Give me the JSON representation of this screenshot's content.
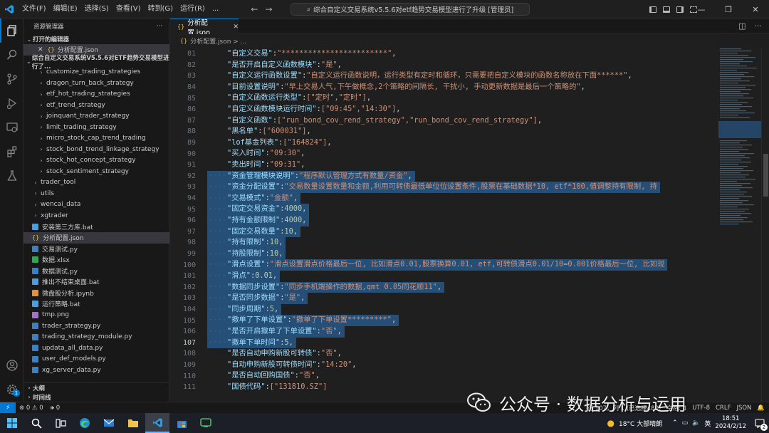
{
  "titlebar": {
    "menu": [
      "文件(F)",
      "编辑(E)",
      "选择(S)",
      "查看(V)",
      "转到(G)",
      "运行(R)",
      "..."
    ],
    "search_text": "综合自定义交易系统v5.5.6对etf趋势交易模型进行了升级 [管理员]"
  },
  "sidebar": {
    "title": "资源管理器",
    "open_editors_label": "打开的编辑器",
    "open_editor_item": "分析配置.json",
    "project_label": "综合自定义交易系统V5.5.6对ETF趋势交易模型进行了...",
    "items": [
      {
        "label": "customize_trading_strategies",
        "kind": "folder",
        "indent": 2
      },
      {
        "label": "dragon_turn_back_strategy",
        "kind": "folder",
        "indent": 2
      },
      {
        "label": "etf_hot_trading_strategies",
        "kind": "folder",
        "indent": 2
      },
      {
        "label": "etf_trend_strategy",
        "kind": "folder",
        "indent": 2
      },
      {
        "label": "joinquant_trader_strategy",
        "kind": "folder",
        "indent": 2
      },
      {
        "label": "limit_trading_strategy",
        "kind": "folder",
        "indent": 2
      },
      {
        "label": "micro_stock_cap_trend_trading",
        "kind": "folder",
        "indent": 2
      },
      {
        "label": "stock_bond_trend_linkage_strategy",
        "kind": "folder",
        "indent": 2
      },
      {
        "label": "stock_hot_concept_strategy",
        "kind": "folder",
        "indent": 2
      },
      {
        "label": "stock_sentiment_strategy",
        "kind": "folder",
        "indent": 2
      },
      {
        "label": "trader_tool",
        "kind": "folder",
        "indent": 1
      },
      {
        "label": "utils",
        "kind": "folder",
        "indent": 1
      },
      {
        "label": "wencai_data",
        "kind": "folder",
        "indent": 1
      },
      {
        "label": "xgtrader",
        "kind": "folder",
        "indent": 1
      },
      {
        "label": "安装第三方库.bat",
        "kind": "bat",
        "indent": 1
      },
      {
        "label": "分析配置.json",
        "kind": "json",
        "indent": 1,
        "active": true
      },
      {
        "label": "交易测试.py",
        "kind": "py",
        "indent": 1
      },
      {
        "label": "数据.xlsx",
        "kind": "xlsx",
        "indent": 1
      },
      {
        "label": "数据测试.py",
        "kind": "py",
        "indent": 1
      },
      {
        "label": "推出不结束桌面.bat",
        "kind": "bat",
        "indent": 1
      },
      {
        "label": "微盘股分析.ipynb",
        "kind": "ipynb",
        "indent": 1
      },
      {
        "label": "运行策略.bat",
        "kind": "bat",
        "indent": 1
      },
      {
        "label": "tmp.png",
        "kind": "png",
        "indent": 1
      },
      {
        "label": "trader_strategy.py",
        "kind": "py",
        "indent": 1
      },
      {
        "label": "trading_strategy_module.py",
        "kind": "py",
        "indent": 1
      },
      {
        "label": "updata_all_data.py",
        "kind": "py",
        "indent": 1
      },
      {
        "label": "user_def_models.py",
        "kind": "py",
        "indent": 1
      },
      {
        "label": "xg_server_data.py",
        "kind": "py",
        "indent": 1
      }
    ],
    "outline_label": "大纲",
    "timeline_label": "时间线"
  },
  "editor": {
    "tab_label": "分析配置.json",
    "breadcrumb": "分析配置.json > ...",
    "current_line": "107",
    "lines": [
      {
        "n": "81",
        "key": "自定义交易",
        "val": "\"************************\"",
        "tail": ",",
        "sel": false
      },
      {
        "n": "82",
        "key": "是否开启自定义函数模块",
        "val": "\"是\"",
        "tail": ",",
        "sel": false
      },
      {
        "n": "83",
        "key": "自定义运行函数设置",
        "val": "\"自定义运行函数说明，运行类型有定时和循环，只需要把自定义模块的函数名称放在下面******\"",
        "tail": ",",
        "sel": false
      },
      {
        "n": "84",
        "key": "目前设置说明",
        "val": "\"早上交易人气,下午做概念,2个策略的间隔长, 干扰小, 手动更新数据是最后一个策略的\"",
        "tail": ",",
        "sel": false
      },
      {
        "n": "85",
        "key": "自定义函数运行类型",
        "val": "[\"定时\",\"定时\"]",
        "tail": ",",
        "sel": false
      },
      {
        "n": "86",
        "key": "自定义函数模块运行时间",
        "val": "[\"09:45\",\"14:30\"]",
        "tail": ",",
        "sel": false
      },
      {
        "n": "87",
        "key": "自定义函数",
        "val": "[\"run_bond_cov_rend_strategy\",\"run_bond_cov_rend_strategy\"]",
        "tail": ",",
        "sel": false
      },
      {
        "n": "88",
        "key": "黑名单",
        "val": "[\"600031\"]",
        "tail": ",",
        "sel": false
      },
      {
        "n": "89",
        "key": "lof基金列表",
        "val": "[\"164824\"]",
        "tail": ",",
        "sel": false
      },
      {
        "n": "90",
        "key": "买入时间",
        "val": "\"09:30\"",
        "tail": ",",
        "sel": false
      },
      {
        "n": "91",
        "key": "卖出时间",
        "val": "\"09:31\"",
        "tail": ",",
        "sel": false
      },
      {
        "n": "92",
        "key": "资金管理模块说明",
        "val": "\"程序默认管理方式有数量/资金\"",
        "tail": ",",
        "sel": true
      },
      {
        "n": "93",
        "key": "资金分配设置",
        "val": "\"交易数量设置数量和金额,利用可转债最低单位位设置条件,股票在基础数据*10, etf*100,值调整持有限制, 持",
        "tail": "",
        "sel": true
      },
      {
        "n": "94",
        "key": "交易模式",
        "val": "\"金额\"",
        "tail": ",",
        "sel": true
      },
      {
        "n": "95",
        "key": "固定交易资金",
        "val": "4000",
        "tail": ",",
        "sel": true,
        "num": true
      },
      {
        "n": "96",
        "key": "持有金额限制",
        "val": "4000",
        "tail": ",",
        "sel": true,
        "num": true
      },
      {
        "n": "97",
        "key": "固定交易数量",
        "val": "10",
        "tail": ",",
        "sel": true,
        "num": true
      },
      {
        "n": "98",
        "key": "持有限制",
        "val": "10",
        "tail": ",",
        "sel": true,
        "num": true
      },
      {
        "n": "99",
        "key": "持股限制",
        "val": "10",
        "tail": ",",
        "sel": true,
        "num": true
      },
      {
        "n": "100",
        "key": "滑点设置",
        "val": "\"滑点设置滑点价格最后一位, 比如滑点0.01,股票换算0.01, etf,可转债滑点0.01/10=0.001价格最后一位, 比如现",
        "tail": "",
        "sel": true
      },
      {
        "n": "101",
        "key": "滑点",
        "val": "0.01",
        "tail": ",",
        "sel": true,
        "num": true
      },
      {
        "n": "102",
        "key": "数据同步设置",
        "val": "\"同步手机端操作的数据,qmt 0.05同花顺11\"",
        "tail": ",",
        "sel": true
      },
      {
        "n": "103",
        "key": "是否同步数据",
        "val": "\"是\"",
        "tail": ",",
        "sel": true
      },
      {
        "n": "104",
        "key": "同步周期",
        "val": "5",
        "tail": ",",
        "sel": true,
        "num": true
      },
      {
        "n": "105",
        "key": "撤单了下单设置",
        "val": "\"撤单了下单设置*********\"",
        "tail": ",",
        "sel": true
      },
      {
        "n": "106",
        "key": "是否开启撤单了下单设置",
        "val": "\"否\"",
        "tail": ",",
        "sel": true
      },
      {
        "n": "107",
        "key": "撤单下单时间",
        "val": "5",
        "tail": ",",
        "sel": true,
        "num": true
      },
      {
        "n": "108",
        "key": "是否自动申购新股可转债",
        "val": "\"否\"",
        "tail": ",",
        "sel": false
      },
      {
        "n": "109",
        "key": "自动申购新股可转债时间",
        "val": "\"14:20\"",
        "tail": ",",
        "sel": false
      },
      {
        "n": "110",
        "key": "是否自动回购国债",
        "val": "\"否\"",
        "tail": ",",
        "sel": false
      },
      {
        "n": "111",
        "key": "国债代码",
        "val": "[\"131810.SZ\"]",
        "tail": "",
        "sel": false
      }
    ]
  },
  "statusbar": {
    "remote": "⚡",
    "problems": "⊗ 0 ⚠ 0",
    "ports": "🕪 0",
    "position": "行 107，列 1 (已选择480)",
    "spaces": "空格: 4",
    "encoding": "UTF-8",
    "eol": "CRLF",
    "language": "JSON"
  },
  "taskbar": {
    "weather": "18°C 大部晴朗",
    "ime": "英",
    "time": "18:51",
    "date": "2024/2/12",
    "notif_count": "2"
  },
  "watermark": {
    "text": "公众号 · 数据分析与运用"
  },
  "colors": {
    "accent": "#0078d4",
    "selection": "#264f78",
    "key": "#9cdcfe",
    "string": "#ce9178",
    "number": "#b5cea8"
  }
}
